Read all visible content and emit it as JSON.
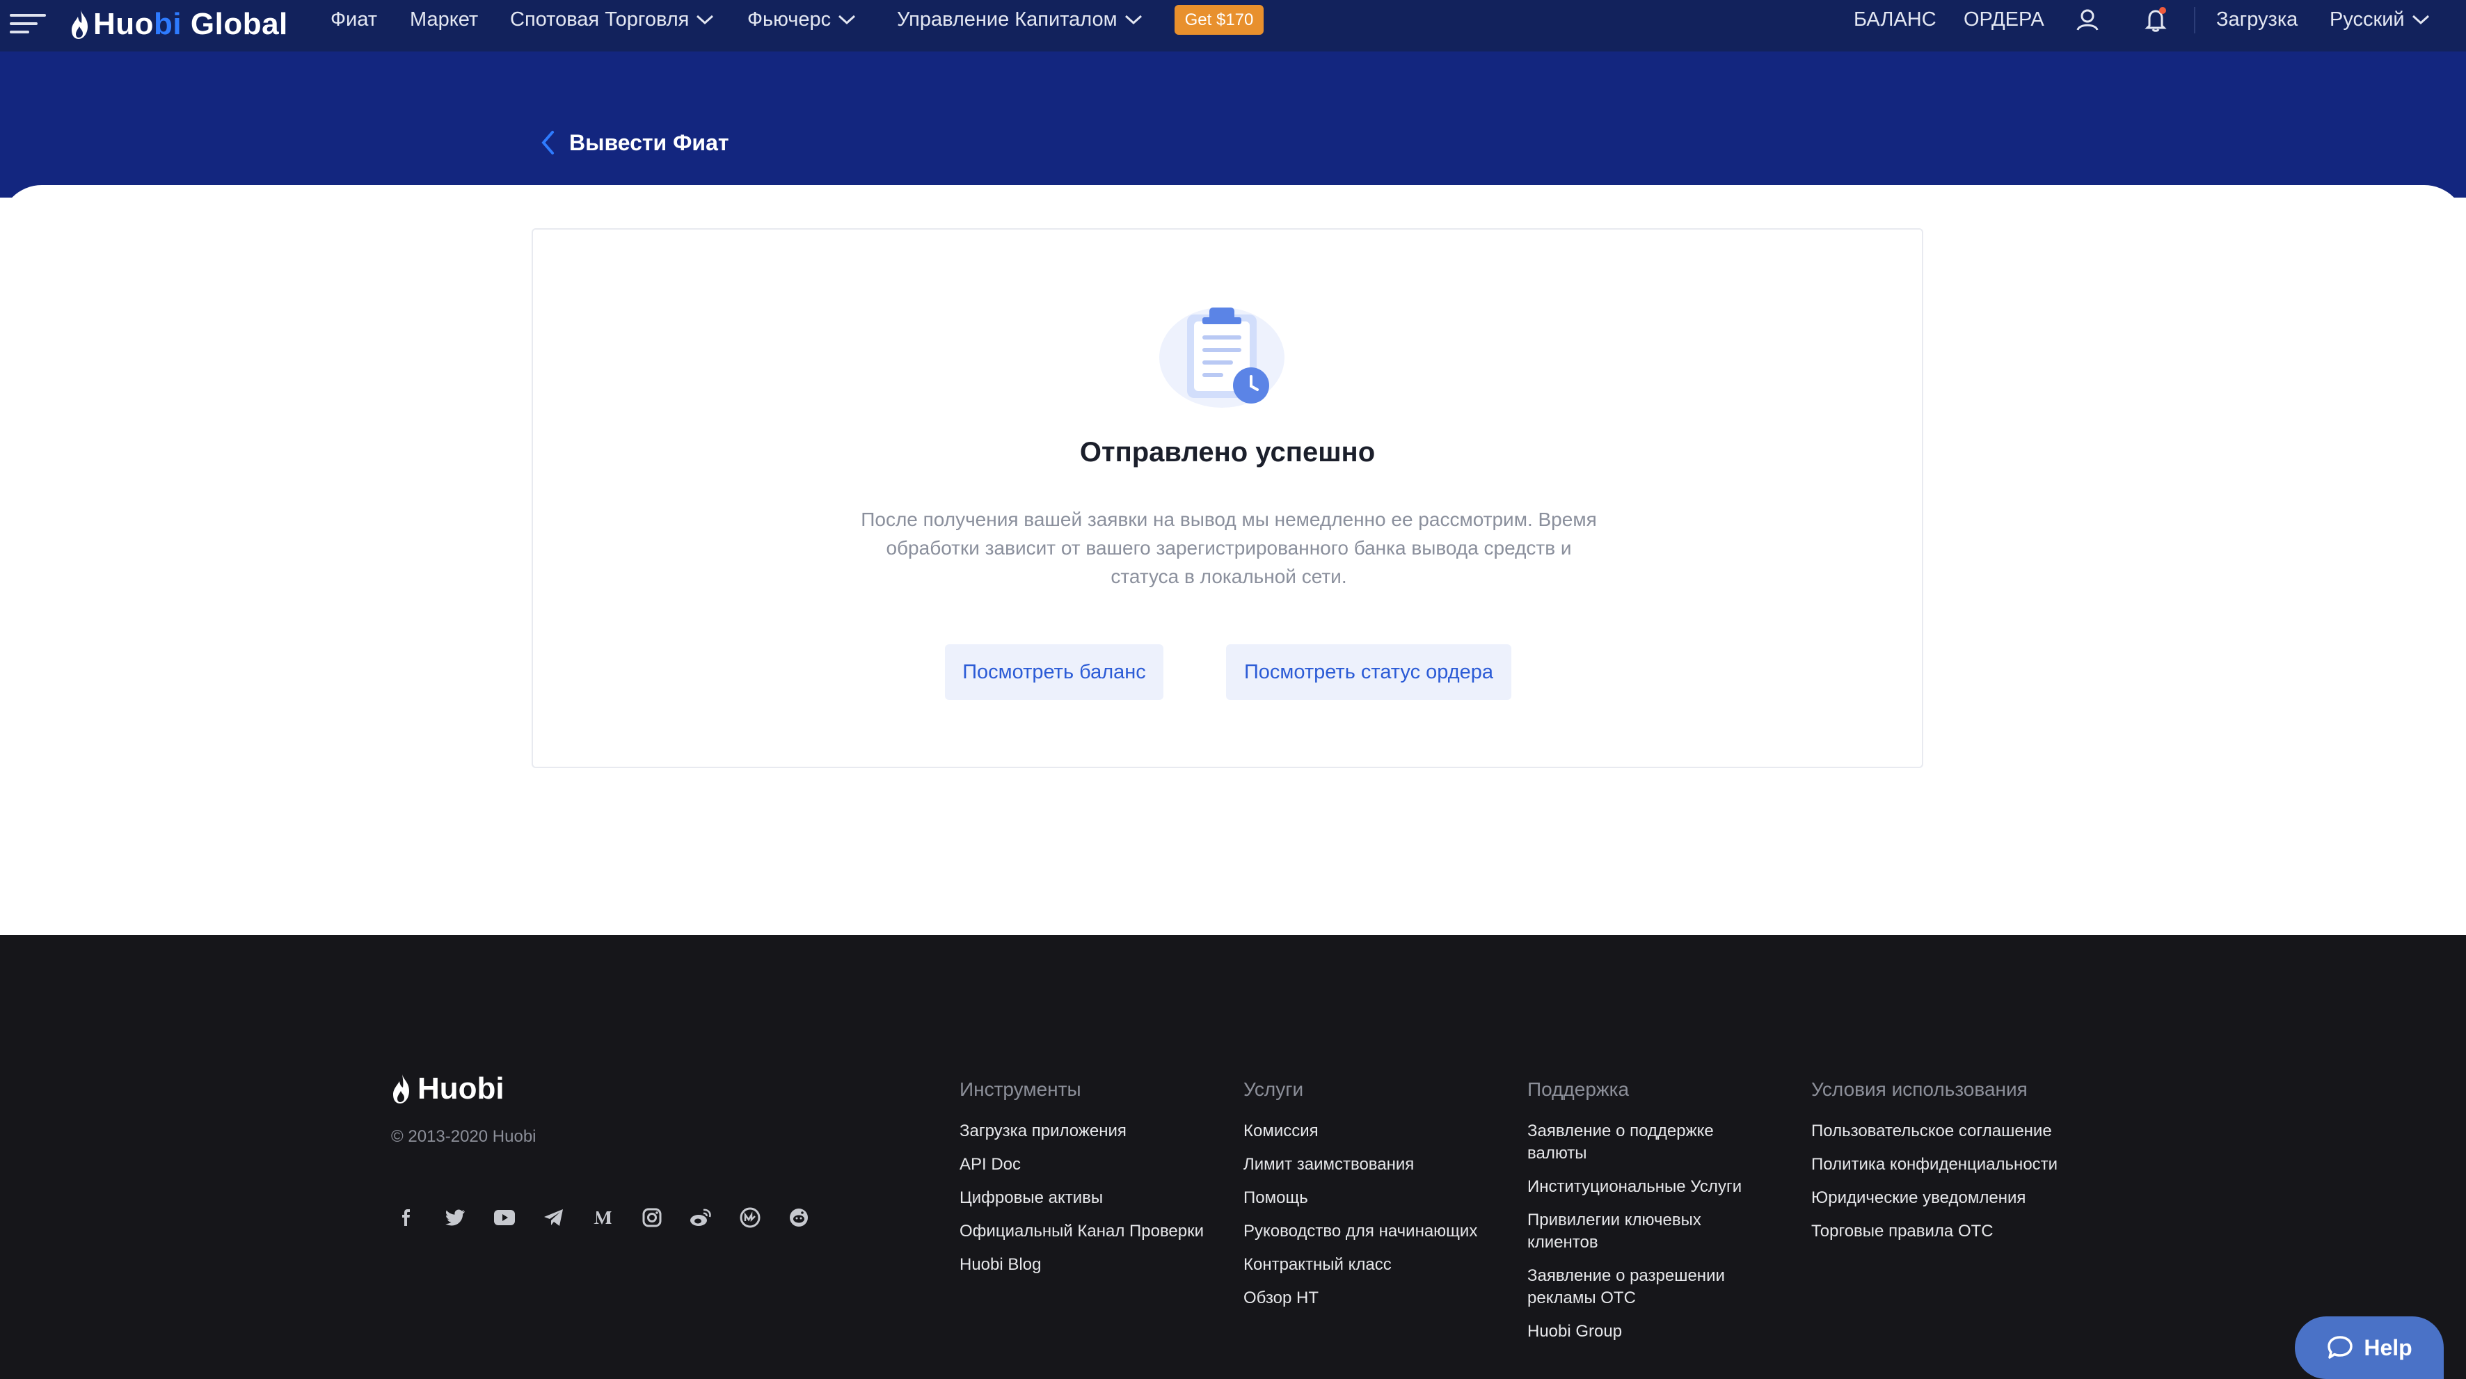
{
  "nav": {
    "logo_main": "Huo",
    "logo_accent": "bi",
    "logo_rest": " Global",
    "items": [
      "Фиат",
      "Маркет",
      "Спотовая Торговля",
      "Фьючерс",
      "Управление Капиталом"
    ],
    "promo": "Get $170",
    "balance": "БАЛАНС",
    "orders": "ОРДЕРА",
    "download": "Загрузка",
    "language": "Русский"
  },
  "header": {
    "back_title": "Вывести Фиат"
  },
  "card": {
    "title": "Отправлено успешно",
    "description": "После получения вашей заявки на вывод мы немедленно ее рассмотрим. Время обработки зависит от вашего зарегистрированного банка вывода средств и статуса в локальной сети.",
    "btn_balance": "Посмотреть баланс",
    "btn_order_status": "Посмотреть статус ордера"
  },
  "footer": {
    "logo": "Huobi",
    "copyright": "© 2013-2020 Huobi",
    "socials": [
      "facebook-icon",
      "twitter-icon",
      "youtube-icon",
      "telegram-icon",
      "medium-icon",
      "instagram-icon",
      "weibo-icon",
      "coinmarketcap-icon",
      "reddit-icon"
    ],
    "columns": [
      {
        "title": "Инструменты",
        "links": [
          "Загрузка приложения",
          "API Doc",
          "Цифровые активы",
          "Официальный Канал Проверки",
          "Huobi Blog"
        ]
      },
      {
        "title": "Услуги",
        "links": [
          "Комиссия",
          "Лимит заимствования",
          "Помощь",
          "Руководство для начинающих",
          "Контрактный класс",
          "Обзор HT"
        ]
      },
      {
        "title": "Поддержка",
        "links": [
          "Заявление о поддержке валюты",
          "Институциональные Услуги",
          "Привилегии ключевых клиентов",
          "Заявление о разрешении рекламы OTC",
          "Huobi Group"
        ]
      },
      {
        "title": "Условия использования",
        "links": [
          "Пользовательское соглашение",
          "Политика конфиденциальности",
          "Юридические уведомления",
          "Торговые правила OTC"
        ]
      }
    ]
  },
  "help": {
    "label": "Help"
  },
  "colors": {
    "nav_bg": "#12225c",
    "band_bg": "#13267f",
    "promo": "#e8902d",
    "button_text": "#2b5bd6",
    "footer_bg": "#16161a",
    "help_bg": "#4a72c7"
  }
}
